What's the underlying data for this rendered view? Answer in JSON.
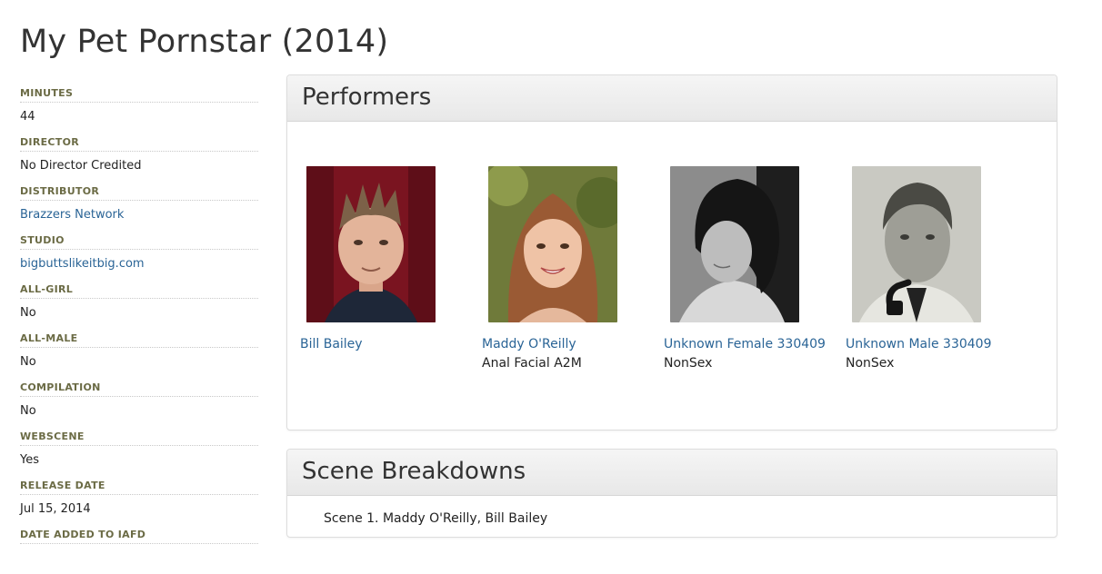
{
  "page": {
    "title": "My Pet Pornstar (2014)"
  },
  "info": [
    {
      "label": "Minutes",
      "value": "44",
      "link": false
    },
    {
      "label": "Director",
      "value": "No Director Credited",
      "link": false
    },
    {
      "label": "Distributor",
      "value": "Brazzers Network",
      "link": true
    },
    {
      "label": "Studio",
      "value": "bigbuttslikeitbig.com",
      "link": true
    },
    {
      "label": "All-Girl",
      "value": "No",
      "link": false
    },
    {
      "label": "All-Male",
      "value": "No",
      "link": false
    },
    {
      "label": "Compilation",
      "value": "No",
      "link": false
    },
    {
      "label": "Webscene",
      "value": "Yes",
      "link": false
    },
    {
      "label": "Release Date",
      "value": "Jul 15, 2014",
      "link": false
    },
    {
      "label": "Date Added to IAFD",
      "value": "",
      "link": false
    }
  ],
  "performers_panel": {
    "title": "Performers",
    "performers": [
      {
        "name": "Bill Bailey",
        "tags": ""
      },
      {
        "name": "Maddy O'Reilly",
        "tags": "Anal Facial A2M"
      },
      {
        "name": "Unknown Female 330409",
        "tags": "NonSex"
      },
      {
        "name": "Unknown Male 330409",
        "tags": "NonSex"
      }
    ]
  },
  "scenes_panel": {
    "title": "Scene Breakdowns",
    "scenes": [
      "Scene 1. Maddy O'Reilly, Bill Bailey"
    ]
  },
  "colors": {
    "link": "#2a6496",
    "label": "#6b6b45",
    "panel_border": "#dddddd"
  }
}
